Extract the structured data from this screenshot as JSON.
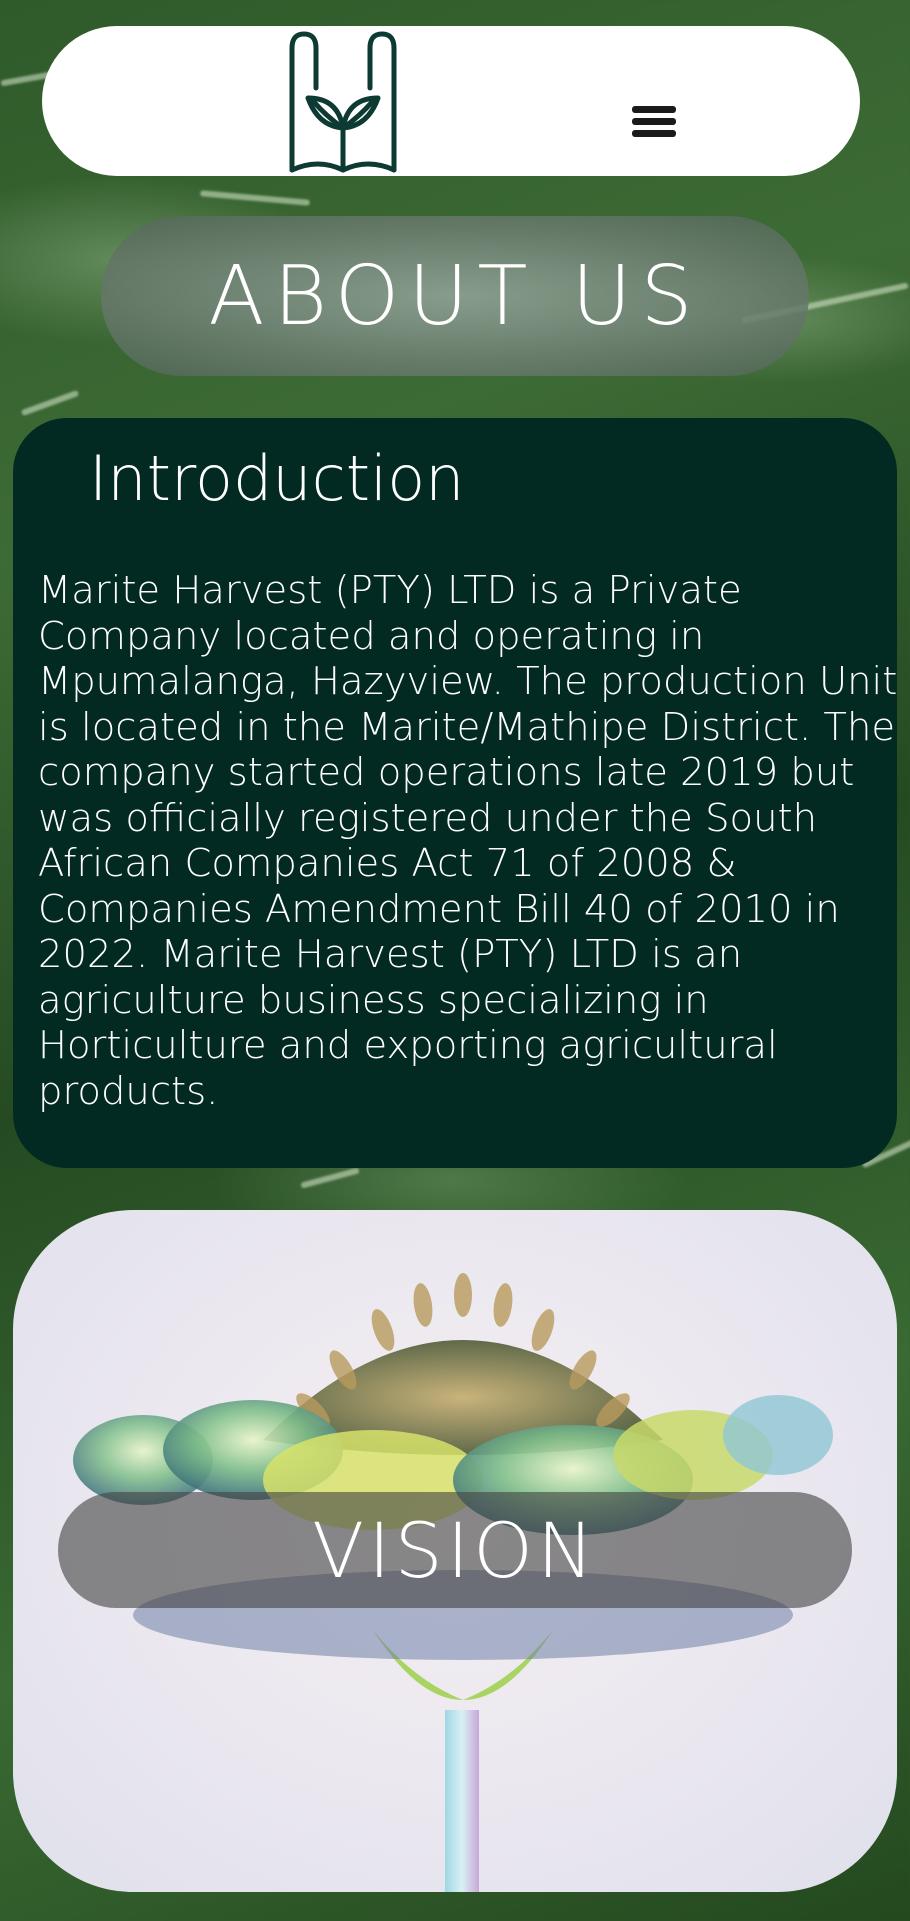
{
  "header": {
    "logo_icon": "leaf-logo-icon",
    "menu_icon": "hamburger-menu-icon"
  },
  "about": {
    "title": "ABOUT US"
  },
  "intro": {
    "heading": "Introduction",
    "body": "Marite Harvest (PTY) LTD is a Private Company located and operating in Mpumalanga, Hazyview. The production Unit is located in the Marite/Mathipe District. The company started operations late 2019 but was officially registered under the South African Companies Act 71 of 2008 & Companies Amendment Bill 40 of 2010 in 2022. Marite Harvest (PTY) LTD is an agriculture business specializing in Horticulture and exporting agricultural products."
  },
  "vision": {
    "title": "VISION",
    "image_icon": "flower-image"
  },
  "colors": {
    "brand_dark": "#022a22",
    "background_green": "#2f5a2a",
    "header_bg": "#ffffff"
  }
}
